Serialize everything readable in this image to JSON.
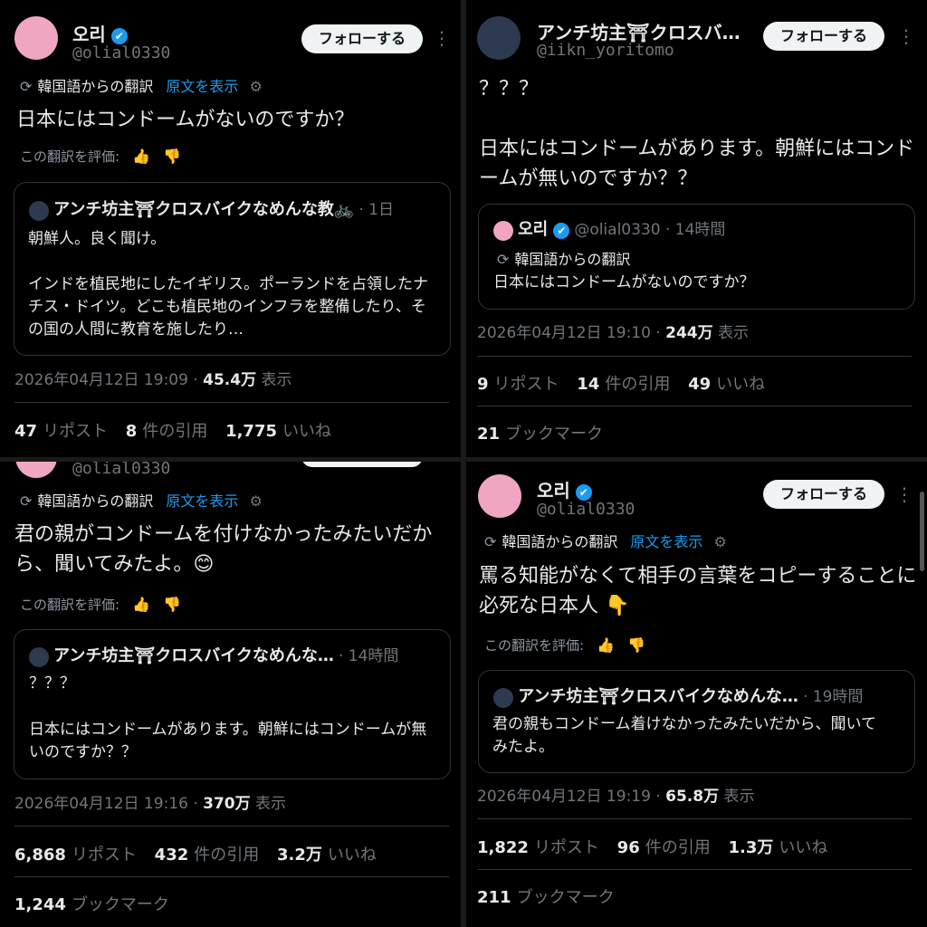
{
  "p1": {
    "name": "오리",
    "handle": "@olial0330",
    "follow": "フォローする",
    "translated_from": "韓国語からの翻訳",
    "show_original": "原文を表示",
    "body": "日本にはコンドームがないのですか？",
    "rate": "この翻訳を評価:",
    "quote": {
      "name": "アンチ坊主⛩クロスバイクなめんな教🚲",
      "time": "· 1日",
      "line1": "朝鮮人。良く聞け。",
      "line2": "インドを植民地にしたイギリス。ポーランドを占領したナチス・ドイツ。どこも植民地のインフラを整備したり、その国の人間に教育を施したり…"
    },
    "datetime": "2026年04月12日 19:09 · ",
    "views_num": "45.4万",
    "views_label": " 表示",
    "reposts_num": "47",
    "reposts_label": "リポスト",
    "quotes_num": "8",
    "quotes_label": "件の引用",
    "likes_num": "1,775",
    "likes_label": "いいね"
  },
  "p2": {
    "name": "アンチ坊主⛩クロスバ…",
    "handle": "@iikn_yoritomo",
    "follow": "フォローする",
    "body1": "？？？",
    "body2": "日本にはコンドームがあります。朝鮮にはコンドームが無いのですか？？",
    "quote": {
      "name": "오리",
      "handle": "@olial0330 · 14時間",
      "translated_from": "韓国語からの翻訳",
      "text": "日本にはコンドームがないのですか？"
    },
    "datetime": "2026年04月12日 19:10 · ",
    "views_num": "244万",
    "views_label": " 表示",
    "reposts_num": "9",
    "reposts_label": "リポスト",
    "quotes_num": "14",
    "quotes_label": "件の引用",
    "likes_num": "49",
    "likes_label": "いいね",
    "bookmarks_num": "21",
    "bookmarks_label": "ブックマーク"
  },
  "p3": {
    "handle": "@olial0330",
    "translated_from": "韓国語からの翻訳",
    "show_original": "原文を表示",
    "body": "君の親がコンドームを付けなかったみたいだから、聞いてみたよ。😊",
    "rate": "この翻訳を評価:",
    "quote": {
      "name": "アンチ坊主⛩クロスバイクなめんな…",
      "time": "· 14時間",
      "line1": "？？？",
      "line2": "日本にはコンドームがあります。朝鮮にはコンドームが無いのですか？？"
    },
    "datetime": "2026年04月12日 19:16 · ",
    "views_num": "370万",
    "views_label": " 表示",
    "reposts_num": "6,868",
    "reposts_label": "リポスト",
    "quotes_num": "432",
    "quotes_label": "件の引用",
    "likes_num": "3.2万",
    "likes_label": "いいね",
    "bookmarks_num": "1,244",
    "bookmarks_label": "ブックマーク"
  },
  "p4": {
    "name": "오리",
    "handle": "@olial0330",
    "follow": "フォローする",
    "translated_from": "韓国語からの翻訳",
    "show_original": "原文を表示",
    "body": "罵る知能がなくて相手の言葉をコピーすることに必死な日本人 👇",
    "rate": "この翻訳を評価:",
    "quote": {
      "name": "アンチ坊主⛩クロスバイクなめんな…",
      "time": "· 19時間",
      "line1": "君の親もコンドーム着けなかったみたいだから、聞いてみたよ。"
    },
    "datetime": "2026年04月12日 19:19 · ",
    "views_num": "65.8万",
    "views_label": " 表示",
    "reposts_num": "1,822",
    "reposts_label": "リポスト",
    "quotes_num": "96",
    "quotes_label": "件の引用",
    "likes_num": "1.3万",
    "likes_label": "いいね",
    "bookmarks_num": "211",
    "bookmarks_label": "ブックマーク"
  },
  "icons": {
    "verified": "✔",
    "more": "⋮",
    "globe": "⟳",
    "gear": "⚙",
    "thumb_up": "👍",
    "thumb_down": "👎"
  }
}
